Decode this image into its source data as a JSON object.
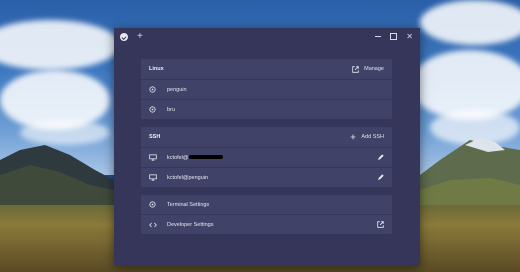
{
  "window": {
    "titlebar": {
      "new_tab_label": "+",
      "close_label": "✕"
    }
  },
  "linux": {
    "title": "Linux",
    "manage_label": "Manage",
    "containers": [
      {
        "name": "penguin"
      },
      {
        "name": "bru"
      }
    ]
  },
  "ssh": {
    "title": "SSH",
    "add_label": "Add SSH",
    "connections": [
      {
        "user_prefix": "kctofel@"
      },
      {
        "label": "kctofel@penguin"
      }
    ]
  },
  "settings": {
    "terminal_label": "Terminal Settings",
    "developer_label": "Developer Settings"
  },
  "icons": {
    "container": "gear-circle-icon",
    "ssh": "monitor-icon",
    "edit": "pencil-icon",
    "external": "open-external-icon",
    "add": "plus-icon",
    "code": "code-brackets-icon"
  },
  "colors": {
    "window_bg": "#35365a",
    "card_bg": "#404267",
    "text": "#e8e8f2"
  }
}
